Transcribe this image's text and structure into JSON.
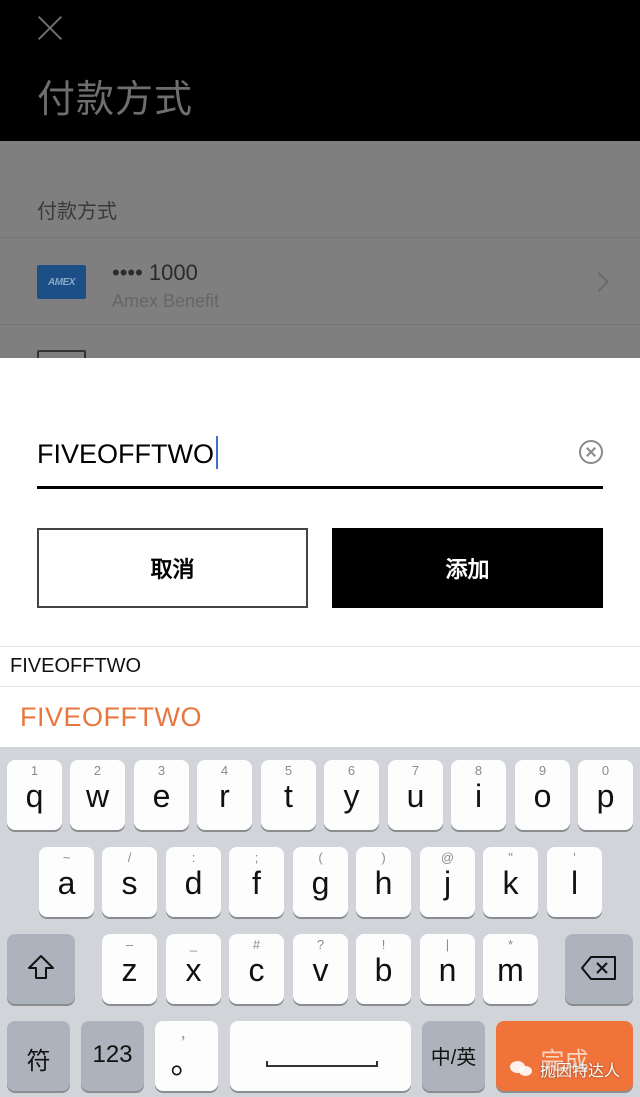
{
  "header": {
    "title": "付款方式"
  },
  "payment": {
    "section_label": "付款方式",
    "card": {
      "logo_text": "AMEX",
      "number": "•••• 1000",
      "name": "Amex Benefit"
    }
  },
  "promo": {
    "value": "FIVEOFFTWO",
    "cancel_label": "取消",
    "add_label": "添加"
  },
  "suggestions": {
    "small": "FIVEOFFTWO",
    "big": "FIVEOFFTWO"
  },
  "keyboard": {
    "row1": [
      {
        "hint": "1",
        "main": "q"
      },
      {
        "hint": "2",
        "main": "w"
      },
      {
        "hint": "3",
        "main": "e"
      },
      {
        "hint": "4",
        "main": "r"
      },
      {
        "hint": "5",
        "main": "t"
      },
      {
        "hint": "6",
        "main": "y"
      },
      {
        "hint": "7",
        "main": "u"
      },
      {
        "hint": "8",
        "main": "i"
      },
      {
        "hint": "9",
        "main": "o"
      },
      {
        "hint": "0",
        "main": "p"
      }
    ],
    "row2": [
      {
        "hint": "~",
        "main": "a"
      },
      {
        "hint": "/",
        "main": "s"
      },
      {
        "hint": ":",
        "main": "d"
      },
      {
        "hint": ";",
        "main": "f"
      },
      {
        "hint": "(",
        "main": "g"
      },
      {
        "hint": ")",
        "main": "h"
      },
      {
        "hint": "@",
        "main": "j"
      },
      {
        "hint": "\"",
        "main": "k"
      },
      {
        "hint": "'",
        "main": "l"
      }
    ],
    "row3": [
      {
        "hint": "–",
        "main": "z"
      },
      {
        "hint": "_",
        "main": "x"
      },
      {
        "hint": "#",
        "main": "c"
      },
      {
        "hint": "?",
        "main": "v"
      },
      {
        "hint": "!",
        "main": "b"
      },
      {
        "hint": "|",
        "main": "n"
      },
      {
        "hint": "*",
        "main": "m"
      }
    ],
    "symbols_label": "符",
    "numbers_label": "123",
    "punct_hint": "，",
    "punct_main": "。",
    "lang_label": "中/英",
    "done_label": "完成"
  },
  "watermark": {
    "text": "抛因特达人"
  }
}
